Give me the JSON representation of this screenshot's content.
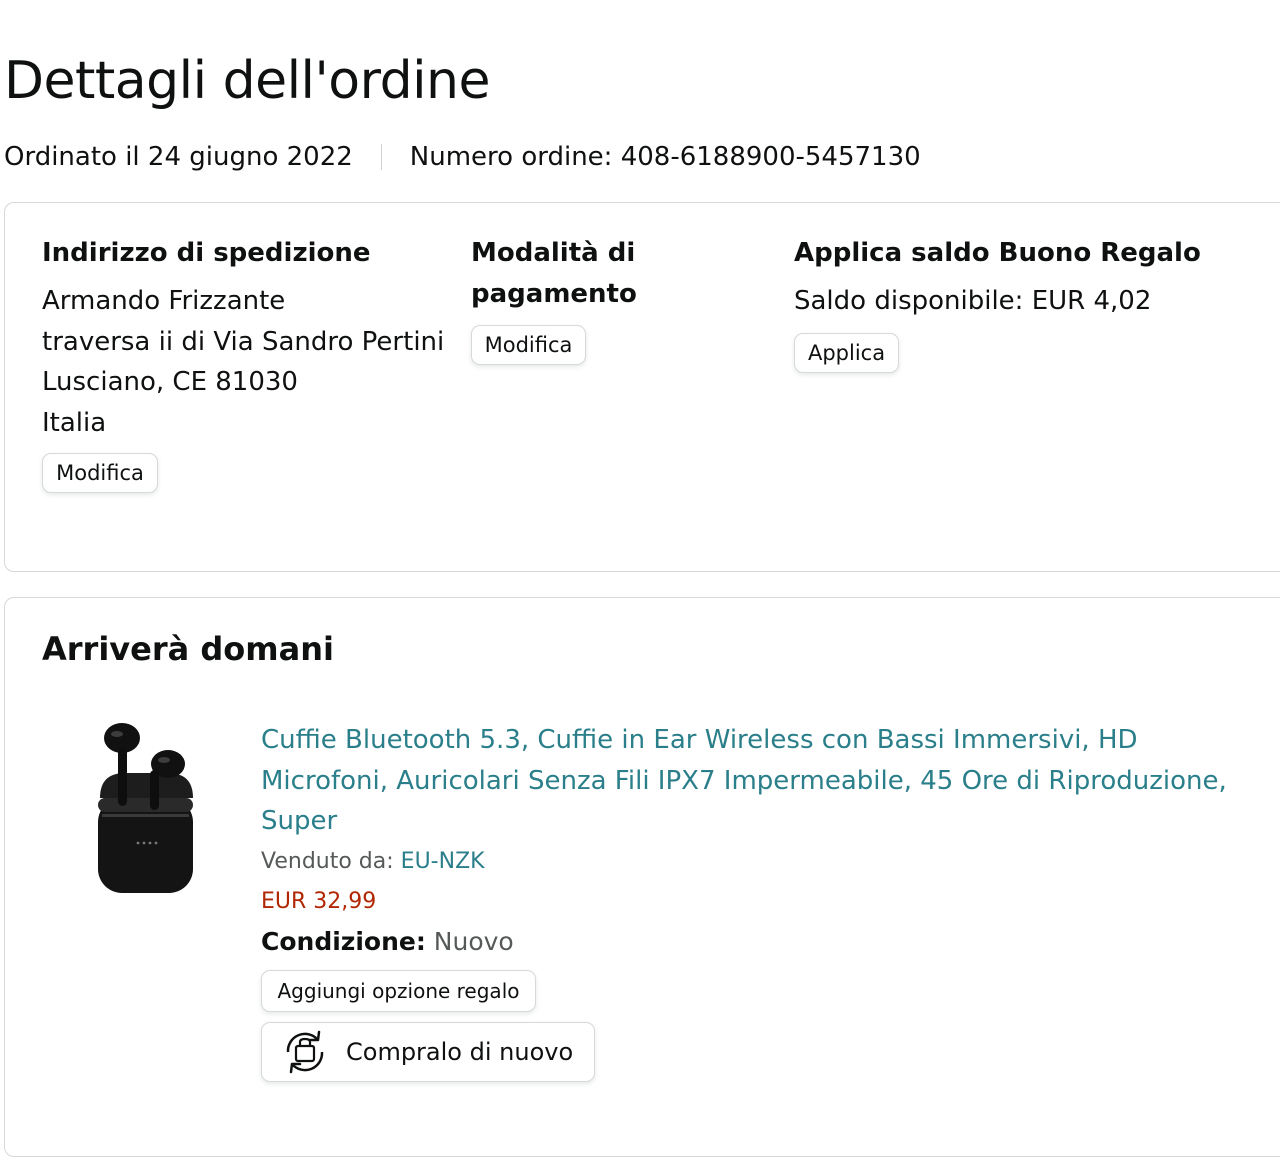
{
  "page": {
    "title": "Dettagli dell'ordine",
    "ordered_on": "Ordinato il 24 giugno 2022",
    "order_number": "Numero ordine: 408-6188900-5457130"
  },
  "shipping": {
    "heading": "Indirizzo di spedizione",
    "name": "Armando Frizzante",
    "street": "traversa ii di Via Sandro Pertini",
    "city": "Lusciano, CE 81030",
    "country": "Italia",
    "edit_label": "Modifica"
  },
  "payment": {
    "heading_line1": "Modalità di",
    "heading_line2": "pagamento",
    "edit_label": "Modifica"
  },
  "gift_card": {
    "heading": "Applica saldo Buono Regalo",
    "balance": "Saldo disponibile: EUR 4,02",
    "apply_label": "Applica"
  },
  "delivery": {
    "heading": "Arriverà domani",
    "item": {
      "title": "Cuffie Bluetooth 5.3, Cuffie in Ear Wireless con Bassi Immersivi, HD Microfoni, Auricolari Senza Fili IPX7 Impermeabile, 45 Ore di Riproduzione, Super",
      "sold_by_label": "Venduto da: ",
      "seller": "EU-NZK",
      "price": "EUR 32,99",
      "condition_label": "Condizione:",
      "condition_value": "Nuovo",
      "gift_option_label": "Aggiungi opzione regalo",
      "buy_again_label": "Compralo di nuovo",
      "image_icon": "earbuds-product-image"
    }
  },
  "colors": {
    "link": "#2a7f8a",
    "price": "#b12704",
    "border": "#d5d9d9"
  }
}
